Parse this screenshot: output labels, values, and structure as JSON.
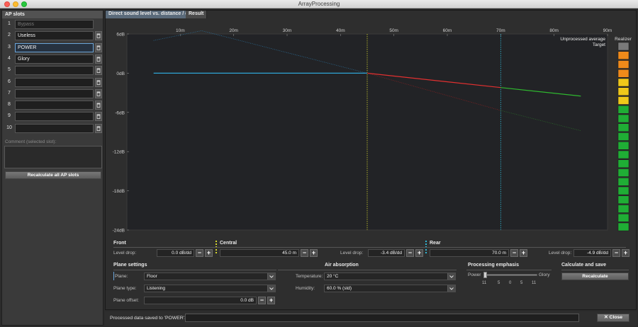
{
  "window": {
    "title": "ArrayProcessing"
  },
  "left_panel": {
    "header": "AP slots",
    "slots": [
      {
        "num": "1",
        "name": "",
        "placeholder": "Bypass",
        "deletable": false
      },
      {
        "num": "2",
        "name": "Useless",
        "placeholder": "",
        "deletable": true
      },
      {
        "num": "3",
        "name": "POWER",
        "placeholder": "",
        "deletable": true,
        "selected": true
      },
      {
        "num": "4",
        "name": "Glory",
        "placeholder": "",
        "deletable": true
      },
      {
        "num": "5",
        "name": "",
        "placeholder": "",
        "deletable": true
      },
      {
        "num": "6",
        "name": "",
        "placeholder": "",
        "deletable": true
      },
      {
        "num": "7",
        "name": "",
        "placeholder": "",
        "deletable": true
      },
      {
        "num": "8",
        "name": "",
        "placeholder": "",
        "deletable": true
      },
      {
        "num": "9",
        "name": "",
        "placeholder": "",
        "deletable": true
      },
      {
        "num": "10",
        "name": "",
        "placeholder": "",
        "deletable": true
      }
    ],
    "comment_label": "Comment (selected slot):",
    "recalc_all_label": "Recalculate all AP slots"
  },
  "tabs": [
    {
      "label": "Direct sound level vs. distance / dB",
      "active": true
    },
    {
      "label": "Result",
      "active": false
    }
  ],
  "chart_data": {
    "type": "line",
    "x_ticks": [
      "10m",
      "20m",
      "30m",
      "40m",
      "50m",
      "60m",
      "70m",
      "80m",
      "90m"
    ],
    "y_ticks": [
      "6dB",
      "0dB",
      "-6dB",
      "-12dB",
      "-18dB",
      "-24dB"
    ],
    "xlim": [
      0,
      90
    ],
    "ylim": [
      -24,
      6
    ],
    "legend": {
      "placement": "top-right",
      "entries": [
        "Unprocessed average",
        "Target"
      ]
    },
    "markers": {
      "front": 0,
      "central": 45,
      "rear": 70
    },
    "series": [
      {
        "color": "#2fa5d6",
        "style": "solid",
        "x": [
          5,
          45
        ],
        "y": [
          0,
          0
        ]
      },
      {
        "color": "#e23030",
        "style": "solid",
        "x": [
          45,
          70
        ],
        "y": [
          0,
          -2.2
        ]
      },
      {
        "color": "#2fb82f",
        "style": "solid",
        "x": [
          70,
          85
        ],
        "y": [
          -2.2,
          -3.5
        ]
      },
      {
        "color": "#2a6f9a",
        "style": "dotted",
        "x": [
          5,
          14,
          45
        ],
        "y": [
          5,
          6.5,
          0
        ]
      },
      {
        "color": "#8a2222",
        "style": "dotted",
        "x": [
          45,
          70
        ],
        "y": [
          0,
          -5.7
        ]
      },
      {
        "color": "#2a6a2a",
        "style": "dotted",
        "x": [
          70,
          85
        ],
        "y": [
          -5.7,
          -8.8
        ]
      }
    ]
  },
  "realizer": {
    "label": "Realizer",
    "cells": [
      "#7a7a7a",
      "#ef8a1a",
      "#ef8a1a",
      "#ef8a1a",
      "#f0c81a",
      "#f0c81a",
      "#f0c81a",
      "#1fae35",
      "#1fae35",
      "#1fae35",
      "#1fae35",
      "#1fae35",
      "#1fae35",
      "#1fae35",
      "#1fae35",
      "#1fae35",
      "#1fae35",
      "#1fae35",
      "#1fae35",
      "#1fae35",
      "#1fae35"
    ]
  },
  "front": {
    "title": "Front",
    "level_drop_label": "Level drop:",
    "level_drop_value": "0.0 dB/dd"
  },
  "central": {
    "title": "Central",
    "distance_value": "45.0 m",
    "level_drop_label": "Level drop:",
    "level_drop_value": "-3.4 dB/dd"
  },
  "rear": {
    "title": "Rear",
    "distance_value": "70.0 m",
    "level_drop_label": "Level drop:",
    "level_drop_value": "-4.9 dB/dd"
  },
  "plane_settings": {
    "title": "Plane settings",
    "plane_label": "Plane:",
    "plane_value": "Floor",
    "type_label": "Plane type:",
    "type_value": "Listening",
    "offset_label": "Plane offset:",
    "offset_value": "0.0 dB"
  },
  "air_absorption": {
    "title": "Air absorption",
    "temp_label": "Temperature:",
    "temp_value": "20 °C",
    "humidity_label": "Humidity:",
    "humidity_value": "60.0 % (std)"
  },
  "processing_emphasis": {
    "title": "Processing emphasis",
    "left_label": "Power",
    "right_label": "Glory",
    "scale": [
      "11",
      "5",
      "0",
      "5",
      "11"
    ],
    "value": 0
  },
  "calculate_save": {
    "title": "Calculate and save",
    "button": "Recalculate"
  },
  "status": {
    "text": "Processed data saved to 'POWER'.",
    "close_label": "✕ Close"
  }
}
